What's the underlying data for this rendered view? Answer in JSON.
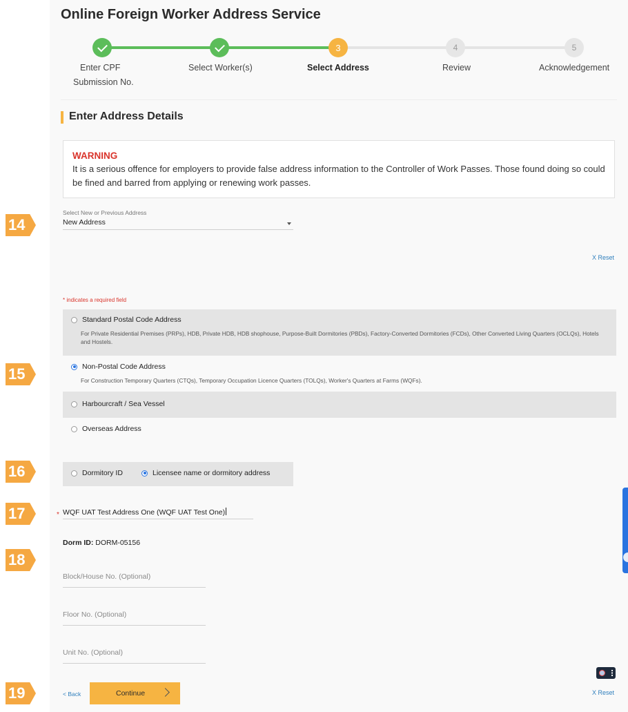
{
  "page": {
    "title": "Online Foreign Worker Address Service"
  },
  "stepper": {
    "steps": [
      {
        "number": "1",
        "label_line1": "Enter CPF",
        "label_line2": "Submission No.",
        "state": "done"
      },
      {
        "number": "2",
        "label_line1": "Select Worker(s)",
        "state": "done"
      },
      {
        "number": "3",
        "label_line1": "Select Address",
        "state": "active"
      },
      {
        "number": "4",
        "label_line1": "Review",
        "state": "todo"
      },
      {
        "number": "5",
        "label_line1": "Acknowledgement",
        "state": "todo"
      }
    ]
  },
  "section": {
    "title": "Enter Address Details"
  },
  "warning": {
    "title": "WARNING",
    "text": "It is a serious offence for employers to provide false address information to the Controller of Work Passes. Those found doing so could be fined and barred from applying or renewing work passes."
  },
  "annotations": [
    "14",
    "15",
    "16",
    "17",
    "18",
    "19"
  ],
  "address_select": {
    "label": "Select New or Previous Address",
    "value": "New Address",
    "reset_label": "X Reset"
  },
  "required_note": {
    "star": "*",
    "text": " indicates a required field"
  },
  "address_types": [
    {
      "label": "Standard Postal Code Address",
      "description": "For Private Residential Premises (PRPs), HDB, Private HDB, HDB shophouse, Purpose-Built Dormitories (PBDs), Factory-Converted Dormitories (FCDs), Other Converted Living Quarters (OCLQs), Hotels and Hostels.",
      "selected": false
    },
    {
      "label": "Non-Postal Code Address",
      "description": "For Construction Temporary Quarters (CTQs), Temporary Occupation Licence Quarters (TOLQs), Worker's Quarters at Farms (WQFs).",
      "selected": true
    },
    {
      "label": "Harbourcraft / Sea Vessel",
      "selected": false
    },
    {
      "label": "Overseas Address",
      "selected": false
    }
  ],
  "search_mode": {
    "options": [
      {
        "label": "Dormitory ID",
        "selected": false
      },
      {
        "label": "Licensee name or dormitory address",
        "selected": true
      }
    ]
  },
  "dorm_search": {
    "value": "WQF UAT Test Address One (WQF UAT Test One)",
    "required_star": "*"
  },
  "dorm_id": {
    "label": "Dorm ID:",
    "value": " DORM-05156"
  },
  "optional_fields": [
    {
      "placeholder": "Block/House No. (Optional)"
    },
    {
      "placeholder": "Floor No. (Optional)"
    },
    {
      "placeholder": "Unit No. (Optional)"
    }
  ],
  "footer": {
    "back_label": "< Back",
    "continue_label": "Continue",
    "reset_label": "X Reset"
  }
}
